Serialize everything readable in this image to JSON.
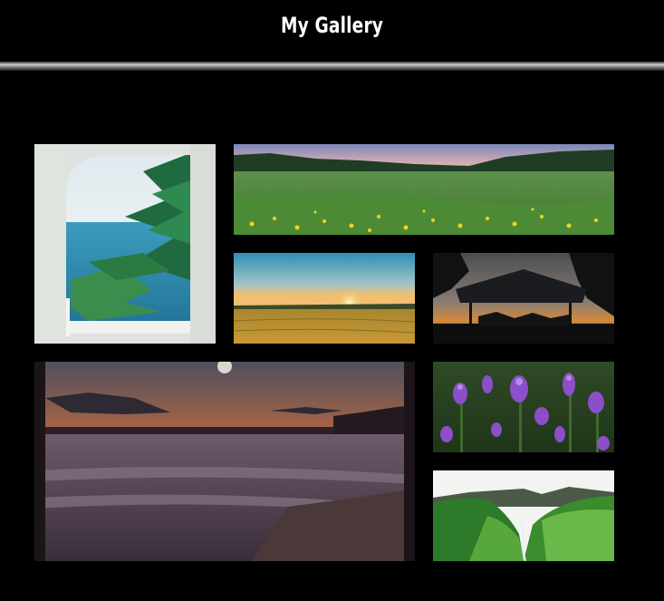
{
  "header": {
    "title": "My Gallery"
  },
  "gallery": {
    "photos": [
      {
        "name": "arched-window-sea-palm",
        "subject": "seaside"
      },
      {
        "name": "green-meadow-yellow-flowers",
        "subject": "meadow"
      },
      {
        "name": "golden-field-sunset",
        "subject": "field"
      },
      {
        "name": "tent-silhouette-sunset",
        "subject": "tent"
      },
      {
        "name": "beach-dusk-long-exposure",
        "subject": "beach"
      },
      {
        "name": "purple-wildflowers",
        "subject": "flowers"
      },
      {
        "name": "green-valley-waterfall",
        "subject": "valley"
      }
    ]
  },
  "colors": {
    "background": "#000000",
    "title": "#ffffff"
  }
}
